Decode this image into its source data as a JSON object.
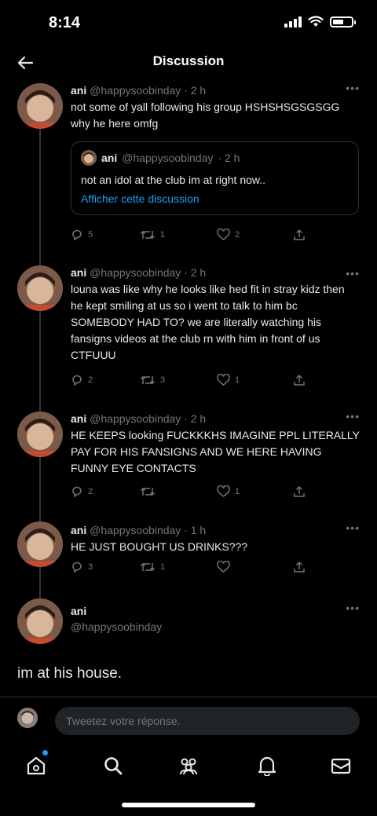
{
  "status": {
    "time": "8:14"
  },
  "header": {
    "title": "Discussion"
  },
  "tweets": [
    {
      "name": "ani",
      "handle": "@happysoobinday",
      "time": "· 2 h",
      "text": "not some of yall following his group HSHSHSGSGSGG why he here omfg",
      "quote": {
        "name": "ani",
        "handle": "@happysoobinday",
        "time": "· 2 h",
        "text": "not an idol at the club im at right now..",
        "link": "Afficher cette discussion"
      },
      "replies": "5",
      "retweets": "1",
      "likes": "2"
    },
    {
      "name": "ani",
      "handle": "@happysoobinday",
      "time": "· 2 h",
      "text": "louna was like why he looks like hed fit in stray kidz then he kept smiling at us so i went to talk to him bc SOMEBODY HAD TO? we are literally watching his fansigns videos at the club rn with him in front of us CTFUUU",
      "replies": "2",
      "retweets": "3",
      "likes": "1"
    },
    {
      "name": "ani",
      "handle": "@happysoobinday",
      "time": "· 2 h",
      "text": "HE KEEPS looking FUCKKKHS IMAGINE PPL LITERALLY PAY FOR HIS FANSIGNS AND WE HERE HAVING FUNNY EYE CONTACTS",
      "replies": "2",
      "retweets": "",
      "likes": "1"
    },
    {
      "name": "ani",
      "handle": "@happysoobinday",
      "time": "· 1 h",
      "text": "HE JUST BOUGHT US DRINKS???",
      "replies": "3",
      "retweets": "1",
      "likes": ""
    }
  ],
  "main_tweet": {
    "name": "ani",
    "handle": "@happysoobinday",
    "text": "im at his house."
  },
  "reply": {
    "placeholder": "Tweetez votre réponse."
  },
  "icons": {
    "more": "more-icon",
    "reply": "reply-icon",
    "retweet": "retweet-icon",
    "like": "heart-icon",
    "share": "share-icon"
  },
  "colors": {
    "background": "#000000",
    "accent": "#1d9bf0",
    "muted": "#71767b",
    "text": "#e7e9ea"
  }
}
